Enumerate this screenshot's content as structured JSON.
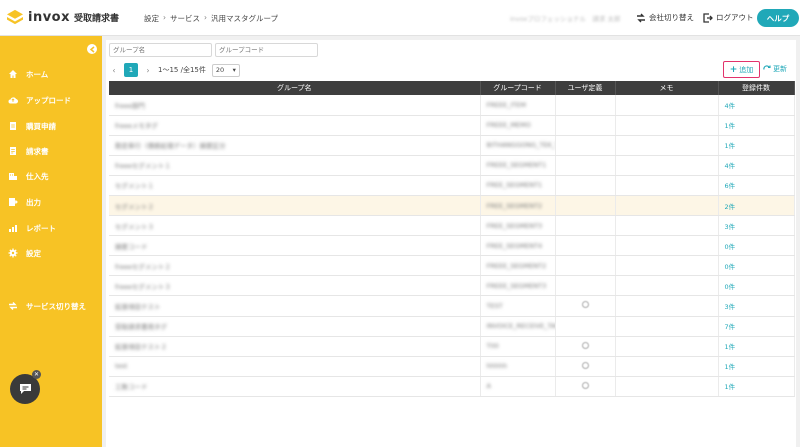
{
  "header": {
    "logo_text": "invox",
    "product_name": "受取請求書",
    "breadcrumb": [
      "設定",
      "サービス",
      "汎用マスタグループ"
    ],
    "user_display": "invoxプロフェッショナル　請求 太郎",
    "company_switch": "会社切り替え",
    "logout": "ログアウト",
    "help": "ヘルプ"
  },
  "sidebar": {
    "items": [
      {
        "label": "ホーム",
        "icon": "home-icon"
      },
      {
        "label": "アップロード",
        "icon": "cloud-upload-icon"
      },
      {
        "label": "購買申請",
        "icon": "document-icon"
      },
      {
        "label": "請求書",
        "icon": "invoice-icon"
      },
      {
        "label": "仕入先",
        "icon": "building-icon"
      },
      {
        "label": "出力",
        "icon": "export-icon"
      },
      {
        "label": "レポート",
        "icon": "chart-icon"
      },
      {
        "label": "設定",
        "icon": "gear-icon"
      },
      {
        "label": "サービス切り替え",
        "icon": "switch-icon"
      }
    ]
  },
  "filters": {
    "group_name_placeholder": "グループ名",
    "group_code_placeholder": "グループコード"
  },
  "pager": {
    "current_page": "1",
    "range_text": "1〜15 /全15件",
    "page_size": "20"
  },
  "actions": {
    "add": "追加",
    "refresh": "更新"
  },
  "table": {
    "headers": [
      "グループ名",
      "グループコード",
      "ユーザ定義",
      "メモ",
      "登録件数"
    ],
    "rows": [
      {
        "name": "freee部門",
        "code": "FREEE_ITEM",
        "user_defined": false,
        "memo": "",
        "count": "4件"
      },
      {
        "name": "freeeメモタグ",
        "code": "FREEE_MEMO",
        "user_defined": false,
        "memo": "",
        "count": "1件"
      },
      {
        "name": "勘定奉行（債務処理データ）摘要区分",
        "code": "BITHANGGONG_TEK_T",
        "user_defined": false,
        "memo": "",
        "count": "1件"
      },
      {
        "name": "freeeセグメント１",
        "code": "FREEE_SEGMENT1",
        "user_defined": false,
        "memo": "",
        "count": "4件"
      },
      {
        "name": "セグメント１",
        "code": "FREE_SEGMENT1",
        "user_defined": false,
        "memo": "",
        "count": "6件"
      },
      {
        "name": "セグメント２",
        "code": "FREE_SEGMENT2",
        "user_defined": false,
        "memo": "",
        "count": "2件",
        "highlight": true
      },
      {
        "name": "セグメント３",
        "code": "FREE_SEGMENT3",
        "user_defined": false,
        "memo": "",
        "count": "3件"
      },
      {
        "name": "摘要コード",
        "code": "FREE_SEGMENT4",
        "user_defined": false,
        "memo": "",
        "count": "0件"
      },
      {
        "name": "freeeセグメント２",
        "code": "FREEE_SEGMENT2",
        "user_defined": false,
        "memo": "",
        "count": "0件"
      },
      {
        "name": "freeeセグメント３",
        "code": "FREEE_SEGMENT3",
        "user_defined": false,
        "memo": "",
        "count": "0件"
      },
      {
        "name": "拡張項目テスト",
        "code": "TEST",
        "user_defined": true,
        "memo": "",
        "count": "3件"
      },
      {
        "name": "受取請求書用タグ",
        "code": "INVOICE_RECEIVE_TAG",
        "user_defined": false,
        "memo": "",
        "count": "7件"
      },
      {
        "name": "拡張項目テスト２",
        "code": "T00",
        "user_defined": true,
        "memo": "",
        "count": "1件"
      },
      {
        "name": "test",
        "code": "hhhhh",
        "user_defined": true,
        "memo": "",
        "count": "1件"
      },
      {
        "name": "工数コード",
        "code": "A",
        "user_defined": true,
        "memo": "",
        "count": "1件"
      }
    ]
  },
  "colors": {
    "accent": "#20a8b8",
    "sidebar": "#f7c325",
    "highlight_border": "#e2336b"
  }
}
